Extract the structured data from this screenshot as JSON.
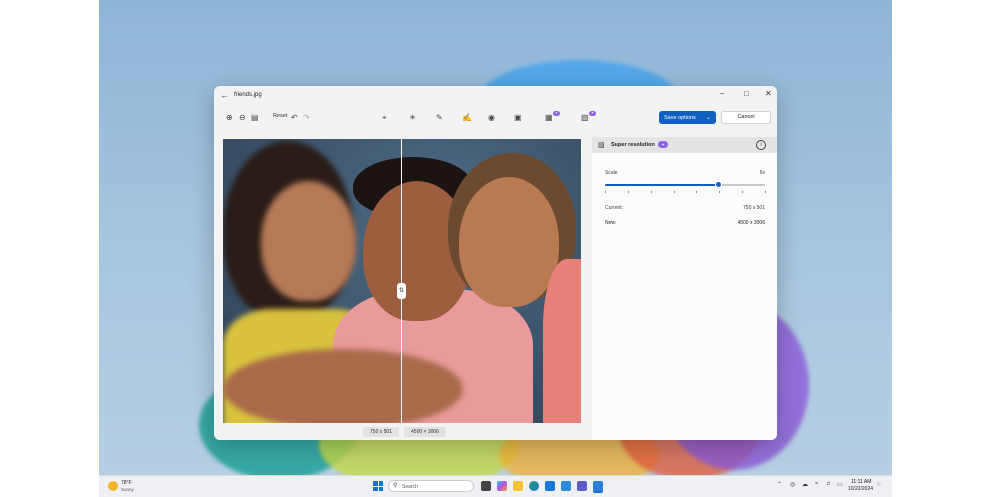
{
  "window": {
    "title": "friends.jpg",
    "back_icon": "back-arrow-icon",
    "controls": [
      "minimize-icon",
      "maximize-icon",
      "close-icon"
    ]
  },
  "toolbar": {
    "left_tools": [
      "zoom-in-icon",
      "zoom-out-icon",
      "fit-to-window-icon"
    ],
    "reset_label": "Reset",
    "undo_icon": "undo-icon",
    "redo_icon": "redo-icon",
    "center_tools": [
      "crop-icon",
      "adjust-icon",
      "erase-icon",
      "markup-icon",
      "filter-icon",
      "background-icon",
      "generative-erase-icon",
      "super-resolution-icon"
    ],
    "save_label": "Save options",
    "cancel_label": "Cancel",
    "accent_color": "#1060c0"
  },
  "image": {
    "before_size": "750 x 501",
    "after_size": "4500 × 3006",
    "compare_handle_icon": "swap-arrows-icon"
  },
  "panel": {
    "title": "Super resolution",
    "badge_icon": "ai-badge-icon",
    "info_icon": "info-icon",
    "scale_label": "Scale",
    "scale_value": "6x",
    "slider_fraction": 0.71,
    "slider_ticks": 8,
    "current_label": "Current:",
    "current_value": "750 x 501",
    "new_label": "New:",
    "new_value": "4500 x 3006"
  },
  "taskbar": {
    "weather_temp": "78°F",
    "weather_condition": "Sunny",
    "search_placeholder": "Search",
    "apps": [
      "copilot-icon",
      "file-explorer-icon",
      "edge-icon",
      "store-icon",
      "teams-icon",
      "photos-icon"
    ],
    "tray_icons": [
      "chevron-up-icon",
      "onedrive-icon",
      "wifi-icon",
      "volume-icon",
      "battery-icon"
    ],
    "time": "11:11 AM",
    "date": "10/22/2024"
  }
}
